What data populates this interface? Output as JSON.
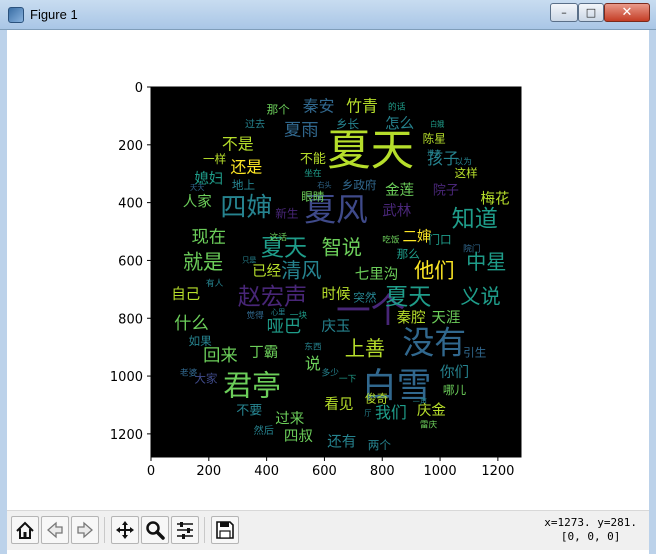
{
  "window": {
    "title": "Figure 1",
    "buttons": {
      "minimize": "–",
      "maximize": "□",
      "close": "✕"
    }
  },
  "plot": {
    "x_ticks": [
      "0",
      "200",
      "400",
      "600",
      "800",
      "1000",
      "1200"
    ],
    "y_ticks": [
      "0",
      "200",
      "400",
      "600",
      "800",
      "1000",
      "1200"
    ],
    "x_tick_values": [
      0,
      200,
      400,
      600,
      800,
      1000,
      1200
    ],
    "y_tick_values": [
      0,
      200,
      400,
      600,
      800,
      1000,
      1200
    ],
    "xlim": [
      0,
      1280
    ],
    "ylim": [
      1280,
      0
    ],
    "background": "#000000",
    "palette": [
      "#440154",
      "#482677",
      "#3f4a8a",
      "#31688e",
      "#26838f",
      "#1f9d8a",
      "#6cce5a",
      "#b6de2b",
      "#fee825"
    ],
    "words": [
      {
        "text": "夏天",
        "x": 760,
        "y": 230,
        "size": 150,
        "c": 7
      },
      {
        "text": "白雪",
        "x": 850,
        "y": 1040,
        "size": 120,
        "c": 3
      },
      {
        "text": "君亭",
        "x": 350,
        "y": 1040,
        "size": 100,
        "c": 6
      },
      {
        "text": "一个",
        "x": 760,
        "y": 780,
        "size": 120,
        "c": 1
      },
      {
        "text": "没有",
        "x": 980,
        "y": 890,
        "size": 110,
        "c": 3
      },
      {
        "text": "夏风",
        "x": 640,
        "y": 430,
        "size": 110,
        "c": 2
      },
      {
        "text": "四婶",
        "x": 330,
        "y": 420,
        "size": 90,
        "c": 4
      },
      {
        "text": "夏天",
        "x": 460,
        "y": 560,
        "size": 80,
        "c": 5
      },
      {
        "text": "夏天",
        "x": 890,
        "y": 730,
        "size": 80,
        "c": 5
      },
      {
        "text": "赵宏声",
        "x": 420,
        "y": 730,
        "size": 80,
        "c": 1
      },
      {
        "text": "知道",
        "x": 1120,
        "y": 460,
        "size": 80,
        "c": 5
      },
      {
        "text": "他们",
        "x": 980,
        "y": 640,
        "size": 70,
        "c": 8
      },
      {
        "text": "中星",
        "x": 1160,
        "y": 610,
        "size": 70,
        "c": 5
      },
      {
        "text": "上善",
        "x": 740,
        "y": 910,
        "size": 70,
        "c": 7
      },
      {
        "text": "义说",
        "x": 1140,
        "y": 730,
        "size": 70,
        "c": 5
      },
      {
        "text": "清风",
        "x": 520,
        "y": 640,
        "size": 70,
        "c": 4
      },
      {
        "text": "智说",
        "x": 660,
        "y": 560,
        "size": 70,
        "c": 6
      },
      {
        "text": "就是",
        "x": 180,
        "y": 610,
        "size": 70,
        "c": 6
      },
      {
        "text": "现在",
        "x": 200,
        "y": 520,
        "size": 60,
        "c": 6
      },
      {
        "text": "回来",
        "x": 240,
        "y": 930,
        "size": 60,
        "c": 6
      },
      {
        "text": "什么",
        "x": 140,
        "y": 820,
        "size": 60,
        "c": 6
      },
      {
        "text": "哑巴",
        "x": 460,
        "y": 830,
        "size": 60,
        "c": 5
      },
      {
        "text": "夏雨",
        "x": 520,
        "y": 150,
        "size": 60,
        "c": 3
      },
      {
        "text": "秦安",
        "x": 580,
        "y": 70,
        "size": 55,
        "c": 3
      },
      {
        "text": "竹青",
        "x": 730,
        "y": 70,
        "size": 55,
        "c": 7
      },
      {
        "text": "不是",
        "x": 300,
        "y": 200,
        "size": 55,
        "c": 7
      },
      {
        "text": "还是",
        "x": 330,
        "y": 280,
        "size": 55,
        "c": 8
      },
      {
        "text": "孩子",
        "x": 1010,
        "y": 250,
        "size": 55,
        "c": 4
      },
      {
        "text": "说",
        "x": 560,
        "y": 960,
        "size": 55,
        "c": 6
      },
      {
        "text": "我们",
        "x": 830,
        "y": 1130,
        "size": 55,
        "c": 5
      },
      {
        "text": "七里沟",
        "x": 780,
        "y": 650,
        "size": 50,
        "c": 6
      },
      {
        "text": "金莲",
        "x": 860,
        "y": 360,
        "size": 50,
        "c": 6
      },
      {
        "text": "武林",
        "x": 850,
        "y": 430,
        "size": 50,
        "c": 1
      },
      {
        "text": "四叔",
        "x": 510,
        "y": 1210,
        "size": 50,
        "c": 6
      },
      {
        "text": "还有",
        "x": 660,
        "y": 1230,
        "size": 50,
        "c": 4
      },
      {
        "text": "过来",
        "x": 480,
        "y": 1150,
        "size": 50,
        "c": 6
      },
      {
        "text": "看见",
        "x": 650,
        "y": 1100,
        "size": 50,
        "c": 7
      },
      {
        "text": "庆金",
        "x": 970,
        "y": 1120,
        "size": 50,
        "c": 7
      },
      {
        "text": "你们",
        "x": 1050,
        "y": 990,
        "size": 50,
        "c": 4
      },
      {
        "text": "秦腔",
        "x": 900,
        "y": 800,
        "size": 50,
        "c": 7
      },
      {
        "text": "天涯",
        "x": 1020,
        "y": 800,
        "size": 50,
        "c": 6
      },
      {
        "text": "时候",
        "x": 640,
        "y": 720,
        "size": 50,
        "c": 7
      },
      {
        "text": "已经",
        "x": 400,
        "y": 640,
        "size": 50,
        "c": 7
      },
      {
        "text": "自己",
        "x": 120,
        "y": 720,
        "size": 50,
        "c": 7
      },
      {
        "text": "人家",
        "x": 160,
        "y": 400,
        "size": 50,
        "c": 6
      },
      {
        "text": "媳妇",
        "x": 200,
        "y": 320,
        "size": 50,
        "c": 5
      },
      {
        "text": "梅花",
        "x": 1190,
        "y": 390,
        "size": 50,
        "c": 7
      },
      {
        "text": "怎么",
        "x": 860,
        "y": 130,
        "size": 50,
        "c": 4
      },
      {
        "text": "二婶",
        "x": 920,
        "y": 520,
        "size": 50,
        "c": 8
      },
      {
        "text": "丁霸",
        "x": 390,
        "y": 920,
        "size": 50,
        "c": 6
      },
      {
        "text": "庆玉",
        "x": 640,
        "y": 830,
        "size": 50,
        "c": 4
      },
      {
        "text": "不要",
        "x": 340,
        "y": 1120,
        "size": 45,
        "c": 4
      },
      {
        "text": "大家",
        "x": 190,
        "y": 1010,
        "size": 40,
        "c": 2
      },
      {
        "text": "如果",
        "x": 170,
        "y": 880,
        "size": 40,
        "c": 4
      },
      {
        "text": "那个",
        "x": 440,
        "y": 80,
        "size": 40,
        "c": 6
      },
      {
        "text": "乡长",
        "x": 680,
        "y": 130,
        "size": 40,
        "c": 4
      },
      {
        "text": "陈星",
        "x": 980,
        "y": 180,
        "size": 40,
        "c": 7
      },
      {
        "text": "一样",
        "x": 220,
        "y": 250,
        "size": 40,
        "c": 7
      },
      {
        "text": "不能",
        "x": 560,
        "y": 250,
        "size": 45,
        "c": 7
      },
      {
        "text": "乡政府",
        "x": 720,
        "y": 340,
        "size": 40,
        "c": 3
      },
      {
        "text": "这样",
        "x": 1090,
        "y": 300,
        "size": 40,
        "c": 7
      },
      {
        "text": "院子",
        "x": 1020,
        "y": 360,
        "size": 45,
        "c": 1
      },
      {
        "text": "地上",
        "x": 320,
        "y": 340,
        "size": 40,
        "c": 4
      },
      {
        "text": "眼睛",
        "x": 560,
        "y": 380,
        "size": 40,
        "c": 6
      },
      {
        "text": "新生",
        "x": 470,
        "y": 440,
        "size": 40,
        "c": 1
      },
      {
        "text": "门口",
        "x": 1000,
        "y": 530,
        "size": 40,
        "c": 5
      },
      {
        "text": "那么",
        "x": 890,
        "y": 580,
        "size": 40,
        "c": 5
      },
      {
        "text": "突然",
        "x": 740,
        "y": 730,
        "size": 40,
        "c": 4
      },
      {
        "text": "引生",
        "x": 1120,
        "y": 920,
        "size": 40,
        "c": 3
      },
      {
        "text": "哪儿",
        "x": 1050,
        "y": 1050,
        "size": 40,
        "c": 6
      },
      {
        "text": "俊奇",
        "x": 780,
        "y": 1080,
        "size": 40,
        "c": 7
      },
      {
        "text": "两个",
        "x": 790,
        "y": 1240,
        "size": 40,
        "c": 4
      },
      {
        "text": "东西",
        "x": 560,
        "y": 900,
        "size": 30,
        "c": 4
      },
      {
        "text": "一块",
        "x": 510,
        "y": 790,
        "size": 30,
        "c": 5
      },
      {
        "text": "觉得",
        "x": 360,
        "y": 790,
        "size": 30,
        "c": 3
      },
      {
        "text": "然后",
        "x": 390,
        "y": 1190,
        "size": 35,
        "c": 4
      },
      {
        "text": "过去",
        "x": 360,
        "y": 130,
        "size": 35,
        "c": 4
      },
      {
        "text": "坐在",
        "x": 560,
        "y": 300,
        "size": 30,
        "c": 5
      },
      {
        "text": "这话",
        "x": 440,
        "y": 520,
        "size": 30,
        "c": 6
      },
      {
        "text": "雷庆",
        "x": 960,
        "y": 1170,
        "size": 30,
        "c": 6
      },
      {
        "text": "吃饭",
        "x": 830,
        "y": 530,
        "size": 30,
        "c": 6
      },
      {
        "text": "以为",
        "x": 1080,
        "y": 260,
        "size": 30,
        "c": 4
      },
      {
        "text": "的话",
        "x": 850,
        "y": 70,
        "size": 30,
        "c": 5
      },
      {
        "text": "多少",
        "x": 620,
        "y": 990,
        "size": 30,
        "c": 4
      },
      {
        "text": "有人",
        "x": 220,
        "y": 680,
        "size": 30,
        "c": 4
      },
      {
        "text": "老婆",
        "x": 130,
        "y": 990,
        "size": 30,
        "c": 3
      },
      {
        "text": "院门",
        "x": 1110,
        "y": 560,
        "size": 30,
        "c": 3
      },
      {
        "text": "只是",
        "x": 340,
        "y": 600,
        "size": 25,
        "c": 4
      },
      {
        "text": "天天",
        "x": 160,
        "y": 350,
        "size": 25,
        "c": 3
      },
      {
        "text": "白娥",
        "x": 990,
        "y": 130,
        "size": 25,
        "c": 5
      },
      {
        "text": "心里",
        "x": 440,
        "y": 780,
        "size": 25,
        "c": 4
      },
      {
        "text": "一下",
        "x": 680,
        "y": 1010,
        "size": 30,
        "c": 5
      },
      {
        "text": "进来",
        "x": 980,
        "y": 230,
        "size": 25,
        "c": 4
      },
      {
        "text": "右头",
        "x": 600,
        "y": 340,
        "size": 25,
        "c": 3
      },
      {
        "text": "厅",
        "x": 750,
        "y": 1130,
        "size": 25,
        "c": 4
      },
      {
        "text": "一声",
        "x": 930,
        "y": 1090,
        "size": 25,
        "c": 4
      }
    ]
  },
  "toolbar": {
    "buttons": [
      {
        "name": "home-button",
        "icon": "home-icon"
      },
      {
        "name": "back-button",
        "icon": "arrow-left-icon"
      },
      {
        "name": "forward-button",
        "icon": "arrow-right-icon"
      },
      {
        "name": "pan-button",
        "icon": "move-icon"
      },
      {
        "name": "zoom-button",
        "icon": "magnifier-icon"
      },
      {
        "name": "configure-subplots-button",
        "icon": "sliders-icon"
      },
      {
        "name": "save-button",
        "icon": "floppy-icon"
      }
    ],
    "coords_line1": "x=1273. y=281.",
    "coords_line2": "[0, 0, 0]"
  }
}
